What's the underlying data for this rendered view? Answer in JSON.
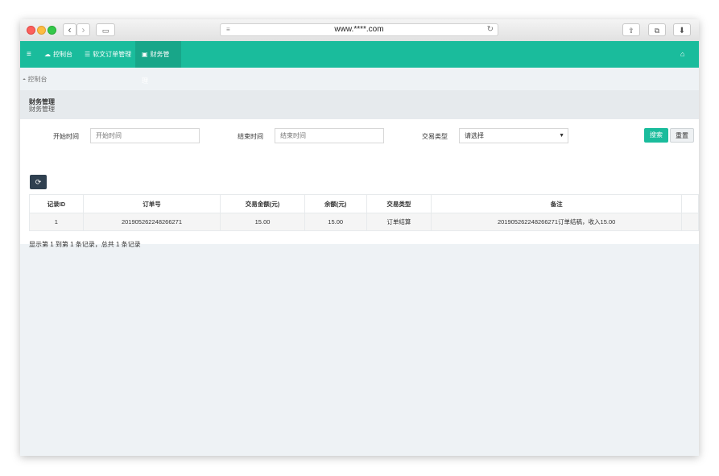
{
  "browser": {
    "url": "www.****.com"
  },
  "nav": {
    "items": [
      {
        "label": "控制台"
      },
      {
        "label": "软文订单管理"
      },
      {
        "label": "财务管理"
      }
    ]
  },
  "breadcrumb": "控制台",
  "page_header": {
    "title": "财务管理",
    "subtitle": "财务管理"
  },
  "filters": {
    "start_label": "开始时间",
    "start_placeholder": "开始时间",
    "end_label": "结束时间",
    "end_placeholder": "结束时间",
    "type_label": "交易类型",
    "type_selected": "请选择",
    "search_label": "搜索",
    "reset_label": "重置"
  },
  "table": {
    "headers": [
      "记录ID",
      "订单号",
      "交易金额(元)",
      "余额(元)",
      "交易类型",
      "备注"
    ],
    "rows": [
      [
        "1",
        "201905262248266271",
        "15.00",
        "15.00",
        "订单结算",
        "201905262248266271订单结稿，收入15.00"
      ]
    ]
  },
  "pagination": "显示第 1 到第 1 条记录，总共 1 条记录",
  "colors": {
    "accent": "#1abc9c",
    "accent_dark": "#18a689",
    "refresh_button": "#2f4050"
  }
}
